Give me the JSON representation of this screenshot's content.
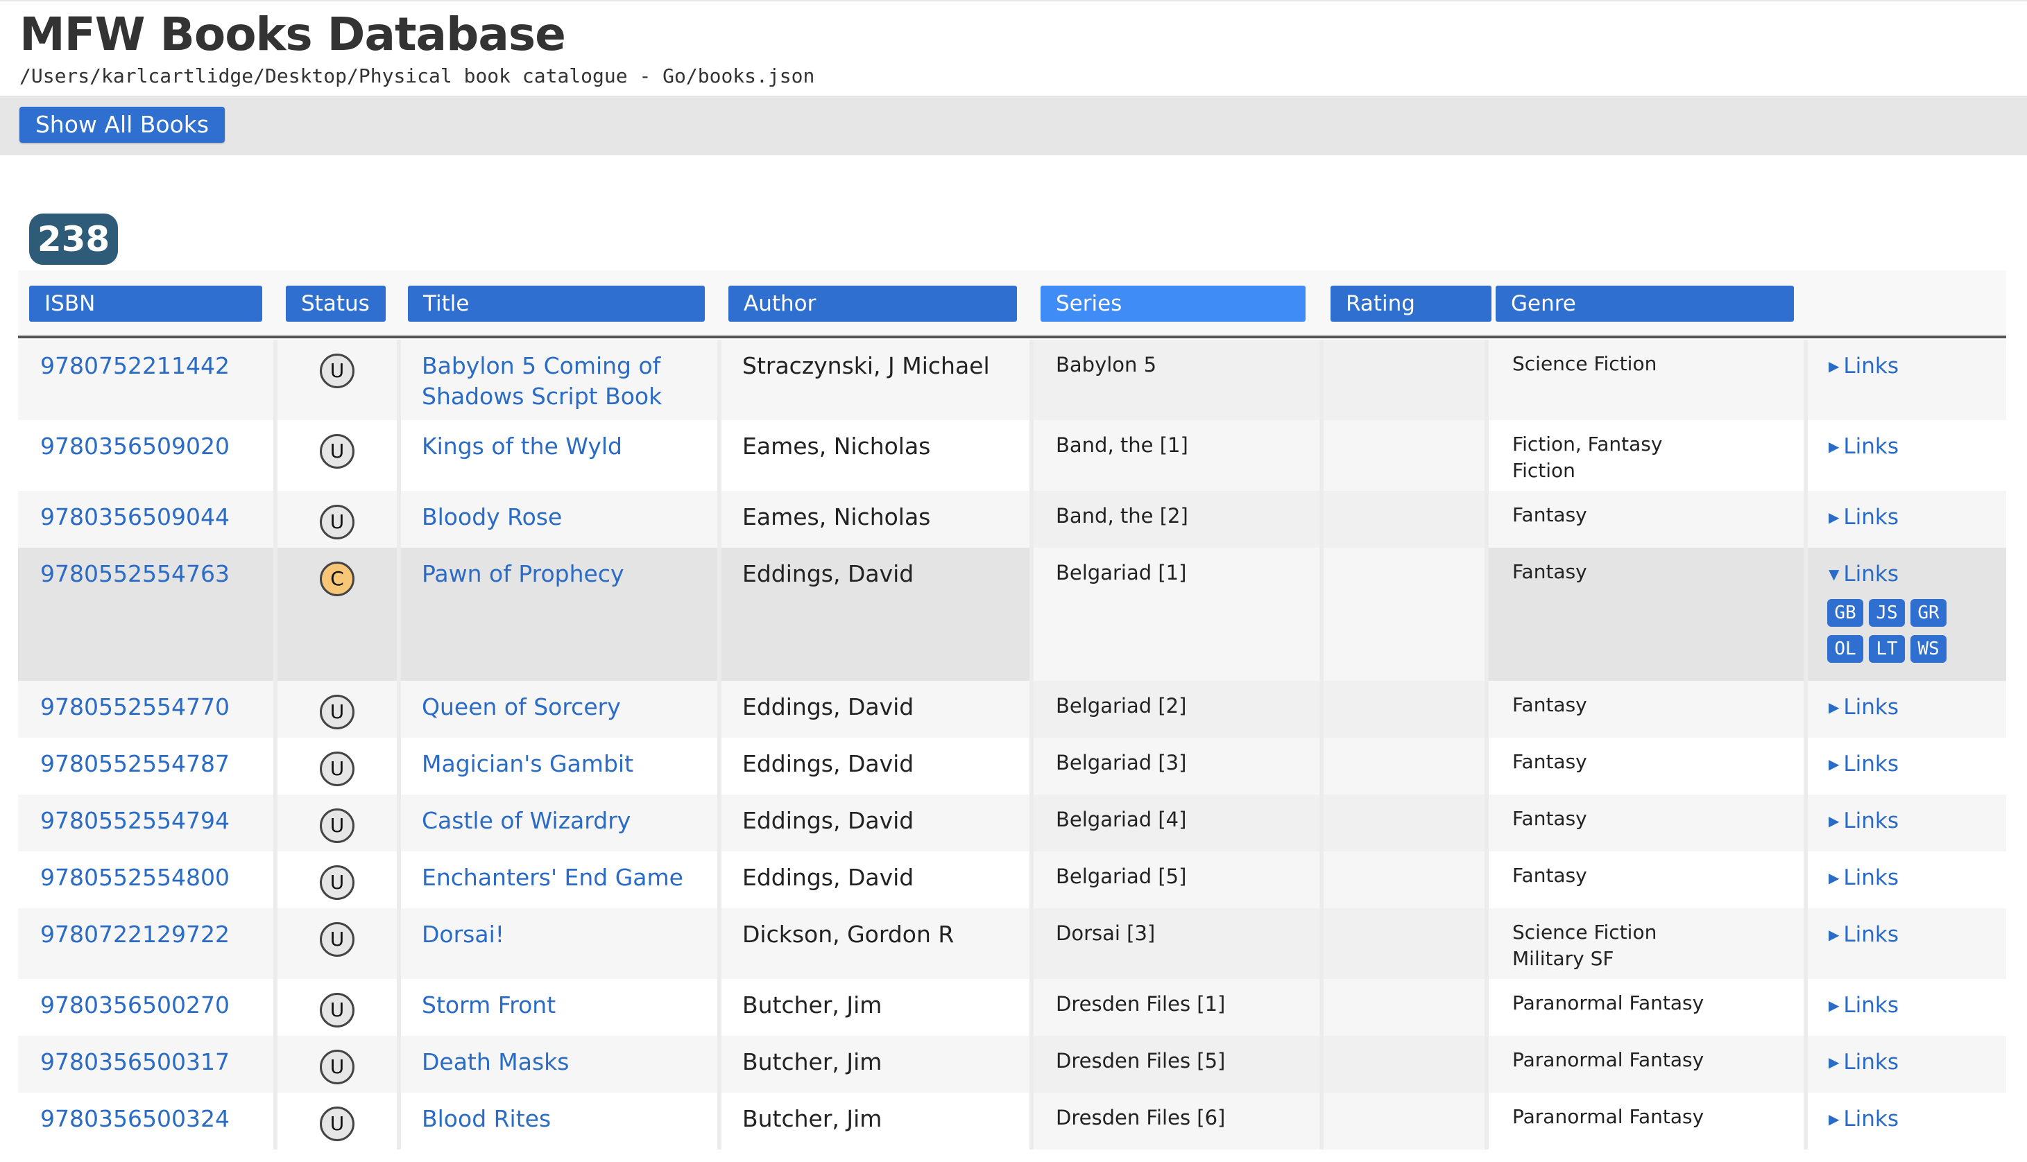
{
  "app": {
    "title": "MFW Books Database",
    "path": "/Users/karlcartlidge/Desktop/Physical book catalogue - Go/books.json"
  },
  "toolbar": {
    "show_all_label": "Show All Books"
  },
  "count": "238",
  "columns": {
    "isbn": "ISBN",
    "status": "Status",
    "title": "Title",
    "author": "Author",
    "series": "Series",
    "rating": "Rating",
    "genre": "Genre",
    "active": "series"
  },
  "colors": {
    "accent": "#2f6fd0",
    "active_header": "#3f8cf7",
    "link": "#2a6bc6",
    "badge": "#2d5b78",
    "status_current": "#f7c777"
  },
  "links_label": "Links",
  "link_badges": [
    "GB",
    "JS",
    "GR",
    "OL",
    "LT",
    "WS"
  ],
  "books": [
    {
      "isbn": "9780752211442",
      "status": "U",
      "title": "Babylon 5 Coming of Shadows Script Book",
      "author": "Straczynski, J Michael",
      "series": "Babylon 5",
      "rating": "",
      "genre": [
        "Science Fiction"
      ],
      "expanded": false
    },
    {
      "isbn": "9780356509020",
      "status": "U",
      "title": "Kings of the Wyld",
      "author": "Eames, Nicholas",
      "series": "Band, the [1]",
      "rating": "",
      "genre": [
        "Fiction, Fantasy",
        "Fiction"
      ],
      "expanded": false
    },
    {
      "isbn": "9780356509044",
      "status": "U",
      "title": "Bloody Rose",
      "author": "Eames, Nicholas",
      "series": "Band, the [2]",
      "rating": "",
      "genre": [
        "Fantasy"
      ],
      "expanded": false
    },
    {
      "isbn": "9780552554763",
      "status": "C",
      "title": "Pawn of Prophecy",
      "author": "Eddings, David",
      "series": "Belgariad [1]",
      "rating": "",
      "genre": [
        "Fantasy"
      ],
      "expanded": true
    },
    {
      "isbn": "9780552554770",
      "status": "U",
      "title": "Queen of Sorcery",
      "author": "Eddings, David",
      "series": "Belgariad [2]",
      "rating": "",
      "genre": [
        "Fantasy"
      ],
      "expanded": false
    },
    {
      "isbn": "9780552554787",
      "status": "U",
      "title": "Magician's Gambit",
      "author": "Eddings, David",
      "series": "Belgariad [3]",
      "rating": "",
      "genre": [
        "Fantasy"
      ],
      "expanded": false
    },
    {
      "isbn": "9780552554794",
      "status": "U",
      "title": "Castle of Wizardry",
      "author": "Eddings, David",
      "series": "Belgariad [4]",
      "rating": "",
      "genre": [
        "Fantasy"
      ],
      "expanded": false
    },
    {
      "isbn": "9780552554800",
      "status": "U",
      "title": "Enchanters' End Game",
      "author": "Eddings, David",
      "series": "Belgariad [5]",
      "rating": "",
      "genre": [
        "Fantasy"
      ],
      "expanded": false
    },
    {
      "isbn": "9780722129722",
      "status": "U",
      "title": "Dorsai!",
      "author": "Dickson, Gordon R",
      "series": "Dorsai [3]",
      "rating": "",
      "genre": [
        "Science Fiction",
        "Military SF"
      ],
      "expanded": false
    },
    {
      "isbn": "9780356500270",
      "status": "U",
      "title": "Storm Front",
      "author": "Butcher, Jim",
      "series": "Dresden Files [1]",
      "rating": "",
      "genre": [
        "Paranormal Fantasy"
      ],
      "expanded": false
    },
    {
      "isbn": "9780356500317",
      "status": "U",
      "title": "Death Masks",
      "author": "Butcher, Jim",
      "series": "Dresden Files [5]",
      "rating": "",
      "genre": [
        "Paranormal Fantasy"
      ],
      "expanded": false
    },
    {
      "isbn": "9780356500324",
      "status": "U",
      "title": "Blood Rites",
      "author": "Butcher, Jim",
      "series": "Dresden Files [6]",
      "rating": "",
      "genre": [
        "Paranormal Fantasy"
      ],
      "expanded": false
    }
  ]
}
